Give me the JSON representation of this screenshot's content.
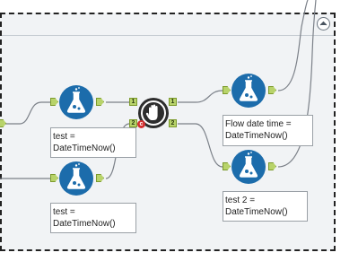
{
  "annotations": {
    "formula_left_top": "test =\nDateTimeNow()",
    "formula_left_bottom": "test =\nDateTimeNow()",
    "formula_right_top": "Flow date time =\nDateTimeNow()",
    "formula_right_bottom": "test 2 =\nDateTimeNow()"
  },
  "anchors": {
    "filter_in_1": "1",
    "filter_in_2": "2",
    "filter_true": "1",
    "filter_false": "2"
  },
  "badges": {
    "filter_status": "c"
  },
  "colors": {
    "tool_blue": "#1c6cab",
    "anchor_green": "#b8d36a",
    "container_bg": "#f1f3f5",
    "filter_dark": "#2d2d2d",
    "error_red": "#d32f2f"
  },
  "icons": {
    "formula": "flask-icon",
    "filter": "hand-stop-icon",
    "collapse": "chevron-up-icon"
  }
}
